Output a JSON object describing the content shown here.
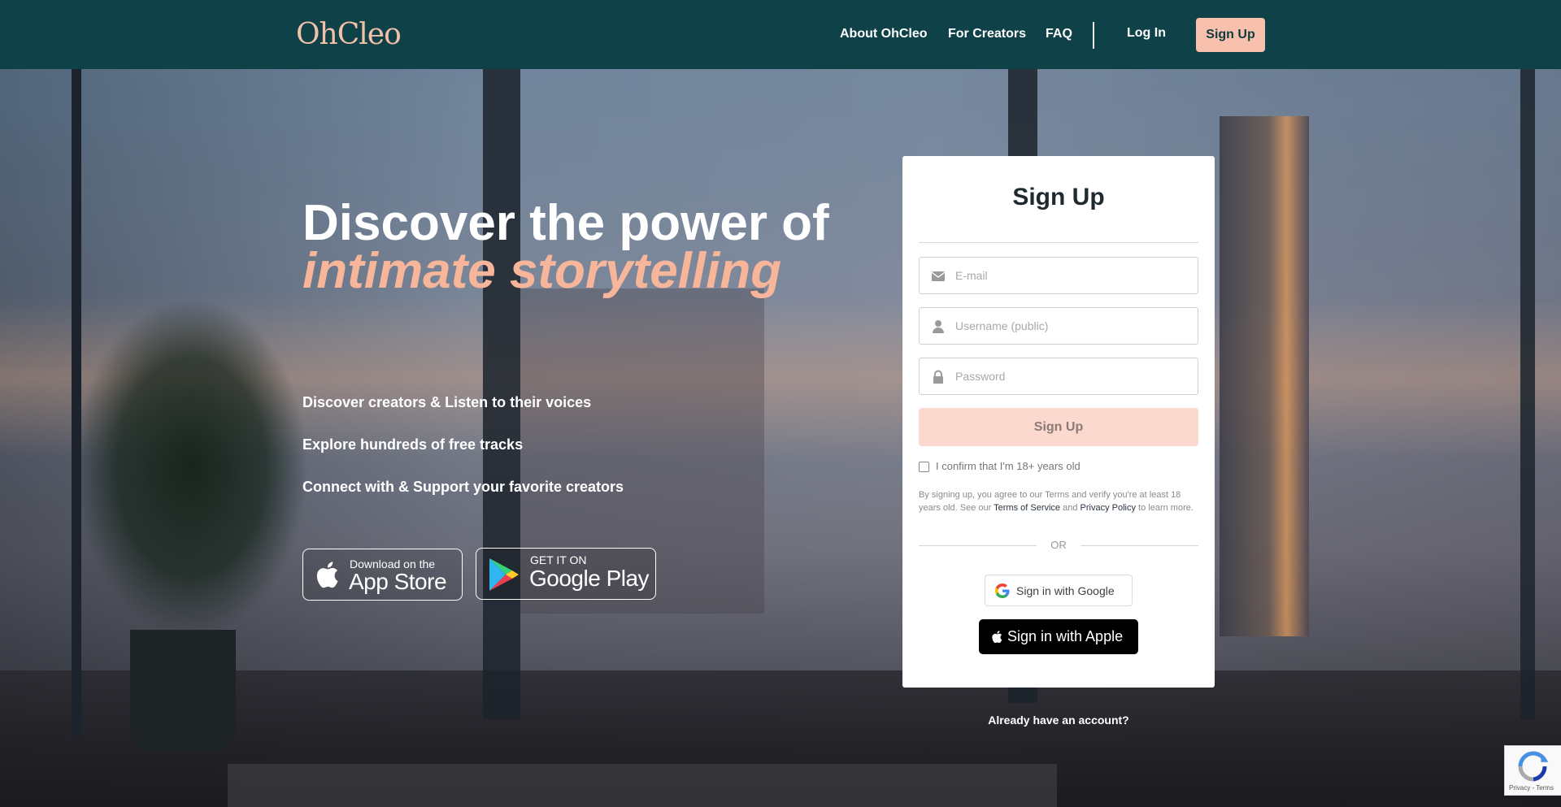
{
  "header": {
    "logo": "OhCleo",
    "nav": [
      "About OhCleo",
      "For Creators",
      "FAQ"
    ],
    "login_label": "Log In",
    "signup_label": "Sign Up",
    "background_color": "#0f4148",
    "accent_color": "#f7c1ae"
  },
  "hero": {
    "headline_line1": "Discover the power of",
    "headline_line2": "intimate storytelling",
    "features": [
      "Discover creators & Listen to their voices",
      "Explore hundreds of free tracks",
      "Connect with & Support your favorite creators"
    ],
    "app_store": {
      "small": "Download on the",
      "big": "App Store",
      "icon": "apple-icon"
    },
    "google_play": {
      "small": "GET IT ON",
      "big": "Google Play",
      "icon": "google-play-icon"
    }
  },
  "signup_form": {
    "title": "Sign Up",
    "email": {
      "placeholder": "E-mail",
      "value": "",
      "icon": "envelope-icon"
    },
    "username": {
      "placeholder": "Username (public)",
      "value": "",
      "icon": "user-icon"
    },
    "password": {
      "placeholder": "Password",
      "value": "",
      "icon": "lock-icon"
    },
    "submit_label": "Sign Up",
    "age_confirm_label": "I confirm that I'm 18+ years old",
    "age_confirmed": false,
    "legal": {
      "prefix": "By signing up, you agree to our Terms and verify you're at least 18 years old. See our ",
      "terms_link": "Terms of Service",
      "and": " and ",
      "privacy_link": "Privacy Policy",
      "suffix": " to learn more."
    },
    "or_label": "OR",
    "google_label": "Sign in with Google",
    "apple_label": "Sign in with Apple",
    "already_label": "Already have an account?"
  },
  "recaptcha": {
    "label": "Privacy - Terms"
  }
}
